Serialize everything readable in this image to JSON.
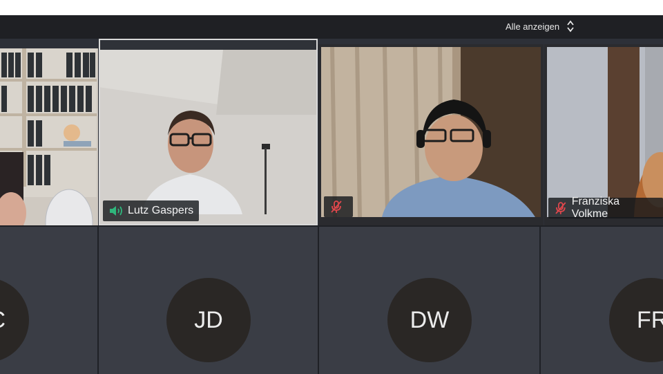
{
  "toolbar": {
    "show_all_label": "Alle anzeigen"
  },
  "participants": [
    {
      "name": "Lutz Gaspers",
      "audio": "speaking"
    },
    {
      "name": "",
      "audio": "muted"
    },
    {
      "name": "Franziska Volkme",
      "audio": "muted"
    }
  ],
  "avatars": [
    {
      "initials": "C"
    },
    {
      "initials": "JD"
    },
    {
      "initials": "DW"
    },
    {
      "initials": "FR"
    }
  ],
  "colors": {
    "speaking": "#2fb67c",
    "muted": "#e0474c",
    "active_border": "#d9d9d9"
  }
}
